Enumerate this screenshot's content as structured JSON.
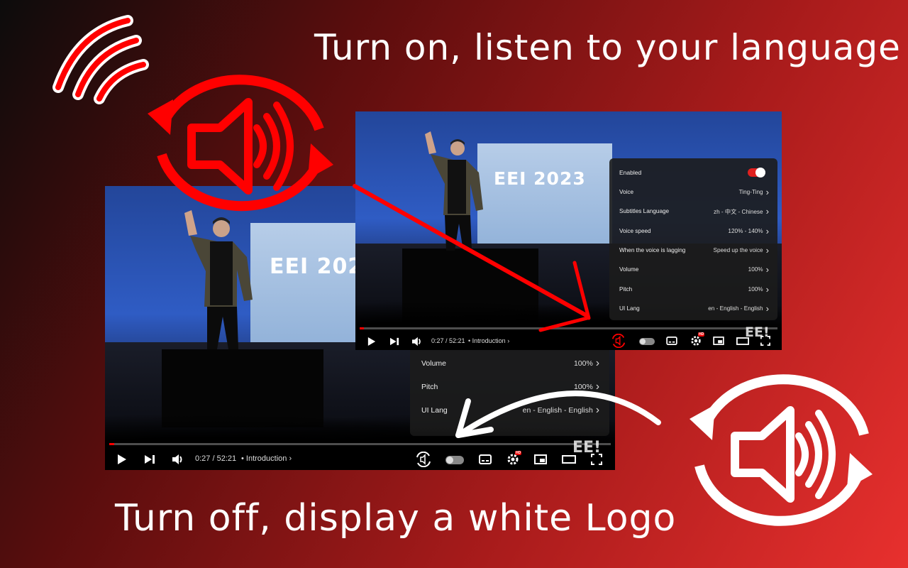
{
  "headlines": {
    "top": "Turn on, listen to your language",
    "bottom": "Turn off, display a white Logo"
  },
  "colors": {
    "accent": "#e8302e",
    "logo_active": "#ff0000",
    "logo_inactive": "#ffffff"
  },
  "stage_screen_text": "EEI 2023",
  "player_off": {
    "stage_screen_text": "EEI 202",
    "time": "0:27 / 52:21",
    "chapter": "• Introduction",
    "progress_fraction": 0.01,
    "watermark": "EE!",
    "settings_rows": [
      {
        "label": "When the voice is lagging",
        "value": "Speed up the voice"
      },
      {
        "label": "Volume",
        "value": "100%"
      },
      {
        "label": "Pitch",
        "value": "100%"
      },
      {
        "label": "UI Lang",
        "value": "en - English - English"
      }
    ],
    "icons": [
      "play-icon",
      "next-icon",
      "volume-icon",
      "translate-logo-icon",
      "autoplay-toggle",
      "subtitles-icon",
      "settings-icon",
      "miniplayer-icon",
      "theater-icon",
      "fullscreen-icon"
    ]
  },
  "player_on": {
    "time": "0:27 / 52:21",
    "chapter": "• Introduction",
    "progress_fraction": 0.01,
    "watermark": "EE!",
    "enabled_label": "Enabled",
    "enabled": true,
    "settings_rows": [
      {
        "label": "Voice",
        "value": "Ting-Ting"
      },
      {
        "label": "Subtitles Language",
        "value": "zh - 中文 - Chinese"
      },
      {
        "label": "Voice speed",
        "value": "120% - 140%"
      },
      {
        "label": "When the voice is lagging",
        "value": "Speed up the voice"
      },
      {
        "label": "Volume",
        "value": "100%"
      },
      {
        "label": "Pitch",
        "value": "100%"
      },
      {
        "label": "UI Lang",
        "value": "en - English - English"
      }
    ]
  }
}
